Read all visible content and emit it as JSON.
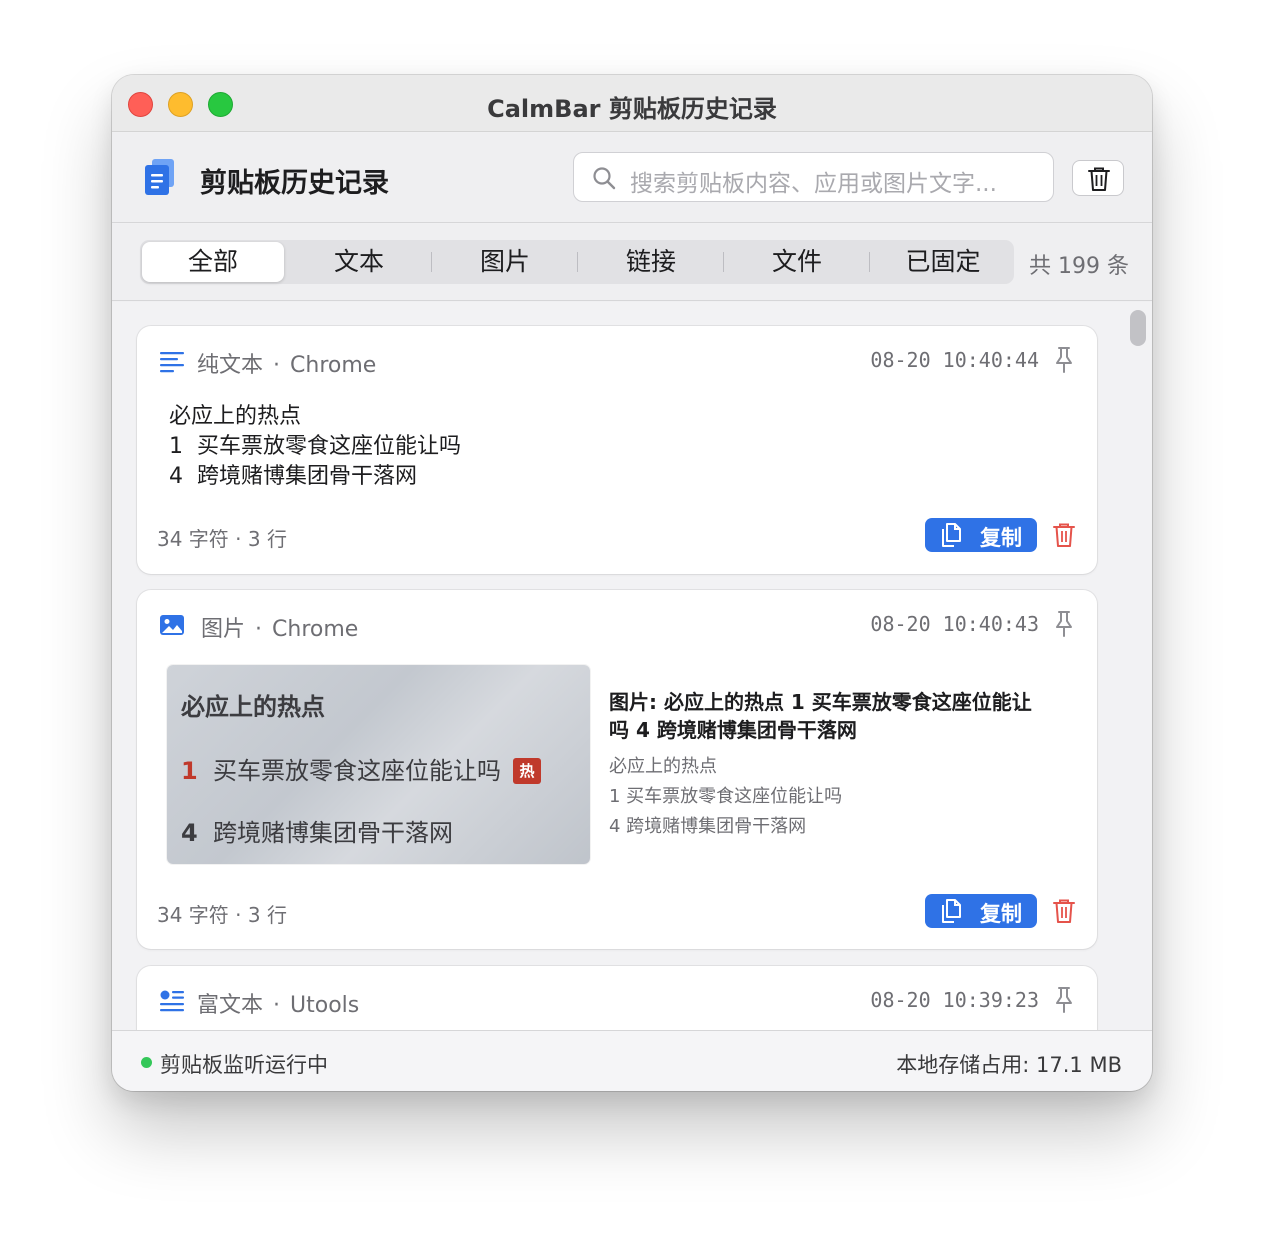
{
  "window": {
    "title": "CalmBar 剪贴板历史记录"
  },
  "header": {
    "title": "剪贴板历史记录",
    "search_placeholder": "搜索剪贴板内容、应用或图片文字..."
  },
  "tabs": [
    {
      "label": "全部",
      "active": true
    },
    {
      "label": "文本",
      "active": false
    },
    {
      "label": "图片",
      "active": false
    },
    {
      "label": "链接",
      "active": false
    },
    {
      "label": "文件",
      "active": false
    },
    {
      "label": "已固定",
      "active": false
    }
  ],
  "count_label": "共 199 条",
  "items": [
    {
      "type": "纯文本",
      "source": "Chrome",
      "time": "08-20 10:40:44",
      "lines": [
        "必应上的热点",
        "1  买车票放零食这座位能让吗",
        "4  跨境赌博集团骨干落网"
      ],
      "stats": "34 字符 · 3 行",
      "copy_label": "复制",
      "icon": "text-lines-icon"
    },
    {
      "type": "图片",
      "source": "Chrome",
      "time": "08-20 10:40:43",
      "image": {
        "title": "必应上的热点",
        "rows": [
          {
            "num": "1",
            "text": "买车票放零食这座位能让吗",
            "badge": "热"
          },
          {
            "num": "4",
            "text": "跨境赌博集团骨干落网"
          }
        ]
      },
      "ocr_title": "图片: 必应上的热点 1 买车票放零食这座位能让吗 4 跨境赌博集团骨干落网",
      "ocr_lines": [
        "必应上的热点",
        "1 买车票放零食这座位能让吗",
        "4 跨境赌博集团骨干落网"
      ],
      "stats": "34 字符 · 3 行",
      "copy_label": "复制",
      "icon": "image-icon"
    },
    {
      "type": "富文本",
      "source": "Utools",
      "time": "08-20 10:39:23",
      "icon": "rich-text-icon"
    }
  ],
  "separator": "·",
  "status": {
    "text": "剪贴板监听运行中",
    "storage": "本地存储占用: 17.1 MB"
  },
  "colors": {
    "accent": "#2f72e6",
    "danger": "#e5534b",
    "status_ok": "#34c759"
  }
}
